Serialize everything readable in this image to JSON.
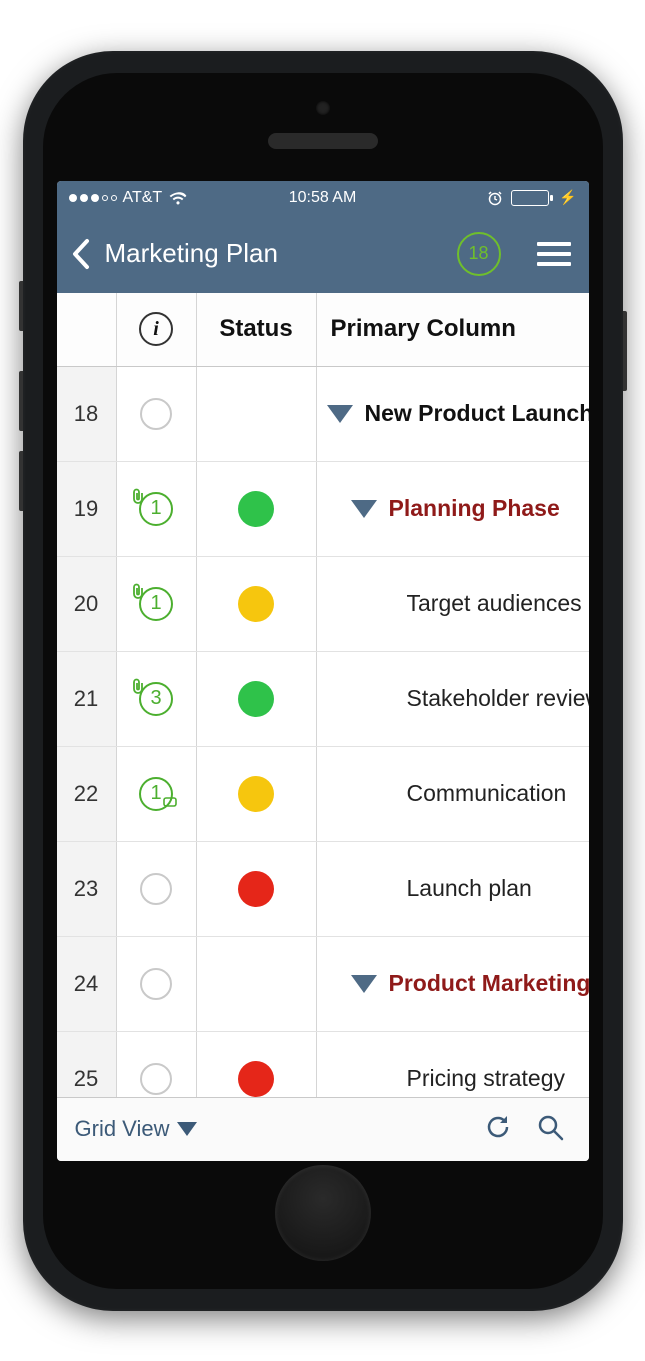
{
  "statusbar": {
    "carrier": "AT&T",
    "time": "10:58 AM"
  },
  "navbar": {
    "title": "Marketing Plan",
    "badge": "18"
  },
  "columns": {
    "status": "Status",
    "primary": "Primary Column"
  },
  "rows": [
    {
      "num": "18",
      "attach": null,
      "clip": false,
      "comment": false,
      "status": null,
      "level": 0,
      "expand": true,
      "style": "bold",
      "text": "New Product Launch"
    },
    {
      "num": "19",
      "attach": "1",
      "clip": true,
      "comment": false,
      "status": "green",
      "level": 1,
      "expand": true,
      "style": "redbold",
      "text": "Planning Phase"
    },
    {
      "num": "20",
      "attach": "1",
      "clip": true,
      "comment": false,
      "status": "yellow",
      "level": 2,
      "expand": false,
      "style": "plain",
      "text": "Target audiences"
    },
    {
      "num": "21",
      "attach": "3",
      "clip": true,
      "comment": false,
      "status": "green",
      "level": 2,
      "expand": false,
      "style": "plain",
      "text": "Stakeholder review"
    },
    {
      "num": "22",
      "attach": "1",
      "clip": false,
      "comment": true,
      "status": "yellow",
      "level": 2,
      "expand": false,
      "style": "plain",
      "text": "Communication"
    },
    {
      "num": "23",
      "attach": null,
      "clip": false,
      "comment": false,
      "status": "red",
      "level": 2,
      "expand": false,
      "style": "plain",
      "text": "Launch plan"
    },
    {
      "num": "24",
      "attach": null,
      "clip": false,
      "comment": false,
      "status": null,
      "level": 1,
      "expand": true,
      "style": "redbold",
      "text": "Product Marketing"
    },
    {
      "num": "25",
      "attach": null,
      "clip": false,
      "comment": false,
      "status": "red",
      "level": 2,
      "expand": false,
      "style": "plain",
      "text": "Pricing strategy"
    }
  ],
  "toolbar": {
    "view": "Grid View"
  }
}
